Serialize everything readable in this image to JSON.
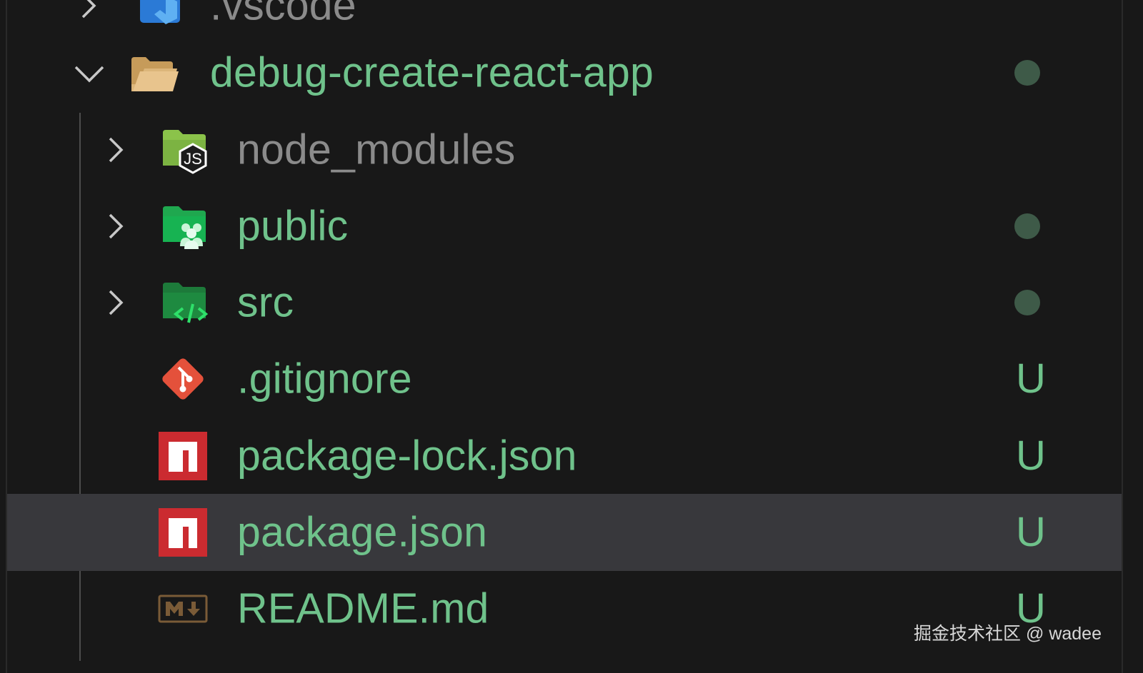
{
  "explorer": {
    "items": [
      {
        "label": ".vscode",
        "expanded": false,
        "type": "folder",
        "icon": "vscode-folder-icon",
        "color": "#8b8b8b"
      },
      {
        "label": "debug-create-react-app",
        "expanded": true,
        "type": "folder",
        "icon": "folder-open-icon",
        "color": "#6fc28b",
        "decoration": "dot"
      },
      {
        "label": "node_modules",
        "expanded": false,
        "type": "folder",
        "icon": "node-folder-icon",
        "color": "#8b8b8b"
      },
      {
        "label": "public",
        "expanded": false,
        "type": "folder",
        "icon": "public-folder-icon",
        "color": "#6fc28b",
        "decoration": "dot"
      },
      {
        "label": "src",
        "expanded": false,
        "type": "folder",
        "icon": "src-folder-icon",
        "color": "#6fc28b",
        "decoration": "dot"
      },
      {
        "label": ".gitignore",
        "type": "file",
        "icon": "git-icon",
        "color": "#6fc28b",
        "status": "U"
      },
      {
        "label": "package-lock.json",
        "type": "file",
        "icon": "npm-icon",
        "color": "#6fc28b",
        "status": "U"
      },
      {
        "label": "package.json",
        "type": "file",
        "icon": "npm-icon",
        "color": "#6fc28b",
        "status": "U",
        "selected": true
      },
      {
        "label": "README.md",
        "type": "file",
        "icon": "markdown-icon",
        "color": "#6fc28b",
        "status": "U"
      }
    ]
  },
  "colors": {
    "untracked": "#6fc28b",
    "ignored": "#8b8b8b",
    "dot": "#3e5a48",
    "selection": "#38383c"
  },
  "watermark": "掘金技术社区 @ wadee"
}
